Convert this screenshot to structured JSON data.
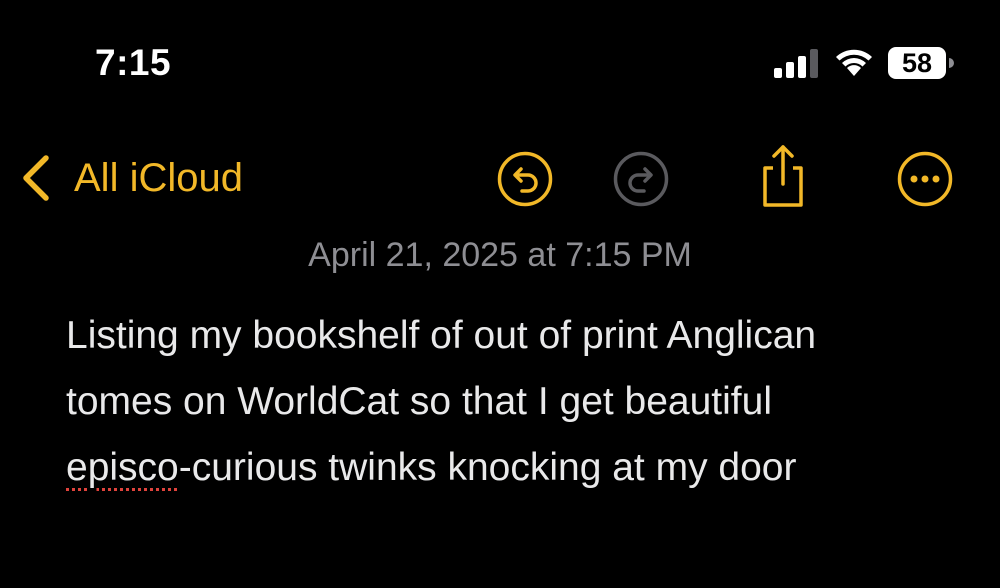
{
  "status_bar": {
    "time": "7:15",
    "battery": "58",
    "signal_icon": "cellular-signal-icon",
    "wifi_icon": "wifi-icon",
    "battery_icon": "battery-icon"
  },
  "nav": {
    "back_label": "All iCloud",
    "back_icon": "chevron-left-icon",
    "undo_icon": "undo-icon",
    "redo_icon": "redo-icon",
    "share_icon": "share-icon",
    "more_icon": "ellipsis-circle-icon",
    "redo_enabled": false
  },
  "colors": {
    "accent": "#F2B828",
    "background": "#000000",
    "date_text": "#8E8E93",
    "body_text": "#E9E9EA",
    "disabled_icon": "#5A5A5E",
    "spellcheck_underline": "#E0433C"
  },
  "note": {
    "date": "April 21, 2025 at 7:15 PM",
    "lines": {
      "line1": "Listing my bookshelf of out of print Anglican",
      "line2": "tomes on WorldCat so that I get beautiful",
      "line3_misspelled": "episco",
      "line3_rest": "-curious twinks knocking at my door"
    }
  }
}
